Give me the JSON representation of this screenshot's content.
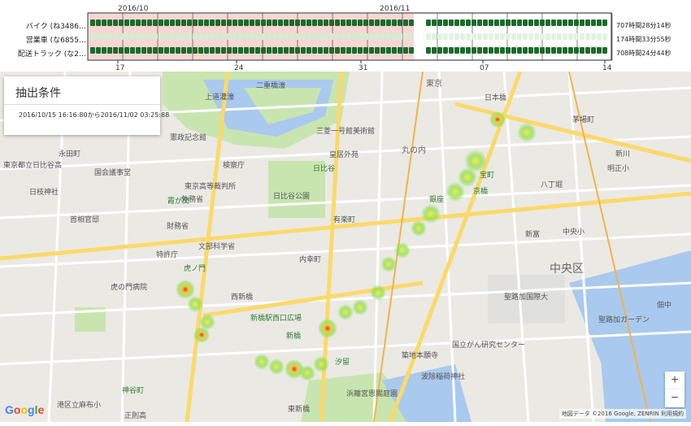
{
  "timeline": {
    "month_labels": [
      "2016/10",
      "2016/11"
    ],
    "rows": [
      {
        "label": "バイク (ね3486…",
        "total": "707時間28分14秒"
      },
      {
        "label": "営業車 (な6855…",
        "total": "174時間33分55秒"
      },
      {
        "label": "配送トラック (な2…",
        "total": "708時間24分44秒"
      }
    ],
    "day_ticks": [
      "17",
      "24",
      "31",
      "07",
      "14"
    ]
  },
  "conditions": {
    "title": "抽出条件",
    "range": "2016/10/15 16:16:80から2016/11/02 03:25:88"
  },
  "map": {
    "labels": {
      "ward": "中央区",
      "l1": "憲政記念館",
      "l2": "東京高等裁判所",
      "l3": "国会議事堂",
      "l4": "首相官邸",
      "l5": "財務省",
      "l6": "文部科学省",
      "l7": "特許庁",
      "l8": "虎の門病院",
      "l9": "日比谷公園",
      "l10": "二重橋濠",
      "l11": "上道灌濠",
      "l12": "皇居外苑",
      "l13": "有楽町",
      "l14": "銀座",
      "l15": "新橋駅西口広場",
      "l16": "新橋",
      "l17": "汐留",
      "l18": "築地本願寺",
      "l19": "国立がん研究センター",
      "l20": "浜離宮恩賜庭園",
      "l21": "聖路加国際大",
      "l22": "聖路加ガーデン",
      "l23": "日本橋",
      "l24": "茅場町",
      "l25": "新川",
      "l26": "明正小",
      "l27": "中央小",
      "l28": "新富",
      "l29": "八丁堀",
      "l30": "京橋",
      "l31": "宝町",
      "l32": "波除稲荷神社",
      "l33": "西新橋",
      "l34": "内幸町",
      "l35": "日比谷",
      "l36": "三菱一号館美術館",
      "l37": "東京",
      "l38": "永田町",
      "l39": "日枝神社",
      "l40": "東京都立日比谷高",
      "l41": "正則高",
      "l42": "東新橋",
      "l43": "霞が関",
      "l44": "外務省",
      "l45": "検察庁",
      "l46": "虎ノ門",
      "l47": "佃中",
      "l48": "丸の内",
      "l49": "港区立麻布小",
      "l50": "神谷町"
    },
    "attribution": "地図データ ©2016 Google, ZENRIN  利用規約",
    "google": "Google"
  },
  "colors": {
    "bar": "#1b6b2b",
    "bar_light": "#d4ecd3",
    "highlight": "#f6d7d4",
    "park": "#c8e5b0",
    "water": "#a9c9ee",
    "road": "#ffffff",
    "road_major": "#fbd96a"
  }
}
